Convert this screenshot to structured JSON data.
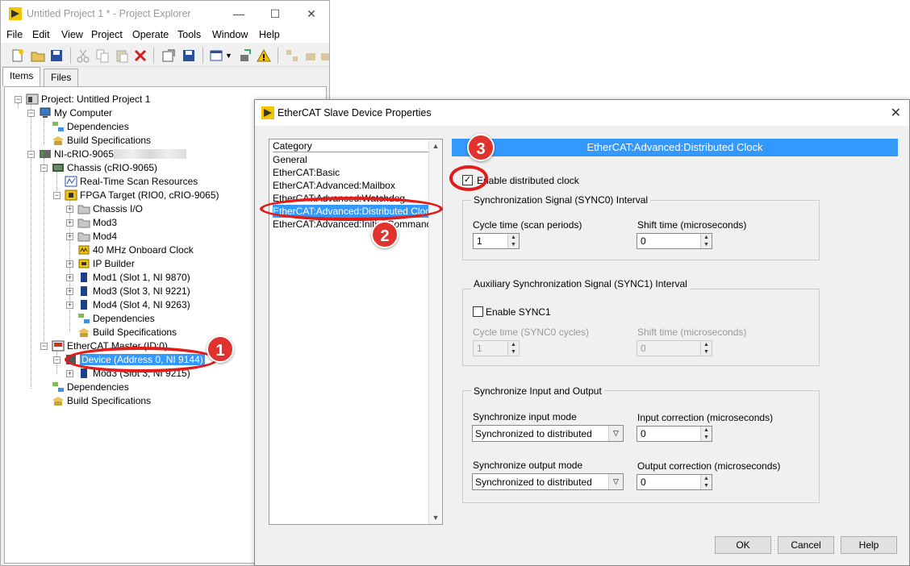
{
  "project_explorer": {
    "title": "Untitled Project 1 * - Project Explorer",
    "window_controls": {
      "minimize": "—",
      "maximize": "☐",
      "close": "✕"
    },
    "menu": [
      "File",
      "Edit",
      "View",
      "Project",
      "Operate",
      "Tools",
      "Window",
      "Help"
    ],
    "tabs": [
      "Items",
      "Files"
    ],
    "tree": {
      "root": "Project: Untitled Project 1",
      "my_computer": "My Computer",
      "mc_dependencies": "Dependencies",
      "mc_build": "Build Specifications",
      "crio": "NI-cRIO-9065",
      "chassis": "Chassis (cRIO-9065)",
      "rt_scan": "Real-Time Scan Resources",
      "fpga": "FPGA Target (RIO0, cRIO-9065)",
      "chassis_io": "Chassis I/O",
      "mod3_folder": "Mod3",
      "mod4_folder": "Mod4",
      "clock": "40 MHz Onboard Clock",
      "ip_builder": "IP Builder",
      "mod1": "Mod1 (Slot 1, NI 9870)",
      "mod3": "Mod3 (Slot 3, NI 9221)",
      "mod4": "Mod4 (Slot 4, NI 9263)",
      "fpga_dependencies": "Dependencies",
      "fpga_build": "Build Specifications",
      "ethercat_master": "EtherCAT Master (ID:0)",
      "device": "Device (Address 0, NI 9144)",
      "mod3_device": "Mod3 (Slot 3, NI 9215)",
      "crio_dependencies": "Dependencies",
      "crio_build": "Build Specifications"
    }
  },
  "dialog": {
    "title": "EtherCAT Slave Device Properties",
    "close": "✕",
    "category_header": "Category",
    "categories": [
      "General",
      "EtherCAT:Basic",
      "EtherCAT:Advanced:Mailbox",
      "EtherCAT:Advanced:Watchdog",
      "EtherCAT:Advanced:Distributed Clock",
      "EtherCAT:Advanced:Initial Commands"
    ],
    "section_header": "EtherCAT:Advanced:Distributed Clock",
    "enable_dc": "Enable distributed clock",
    "sync0": {
      "title": "Synchronization Signal (SYNC0) Interval",
      "cycle_label": "Cycle time (scan periods)",
      "cycle_value": "1",
      "shift_label": "Shift time (microseconds)",
      "shift_value": "0"
    },
    "sync1": {
      "title": "Auxiliary Synchronization Signal (SYNC1) Interval",
      "enable_label": "Enable SYNC1",
      "cycle_label": "Cycle time (SYNC0 cycles)",
      "cycle_value": "1",
      "shift_label": "Shift time (microseconds)",
      "shift_value": "0"
    },
    "sync_io": {
      "title": "Synchronize Input and Output",
      "input_mode_label": "Synchronize input mode",
      "input_mode_value": "Synchronized to distributed",
      "input_corr_label": "Input correction (microseconds)",
      "input_corr_value": "0",
      "output_mode_label": "Synchronize output mode",
      "output_mode_value": "Synchronized to distributed",
      "output_corr_label": "Output correction (microseconds)",
      "output_corr_value": "0"
    },
    "buttons": {
      "ok": "OK",
      "cancel": "Cancel",
      "help": "Help"
    }
  },
  "annotations": [
    "1",
    "2",
    "3"
  ],
  "colors": {
    "selection": "#3399ff",
    "annotation": "#e0332e"
  }
}
